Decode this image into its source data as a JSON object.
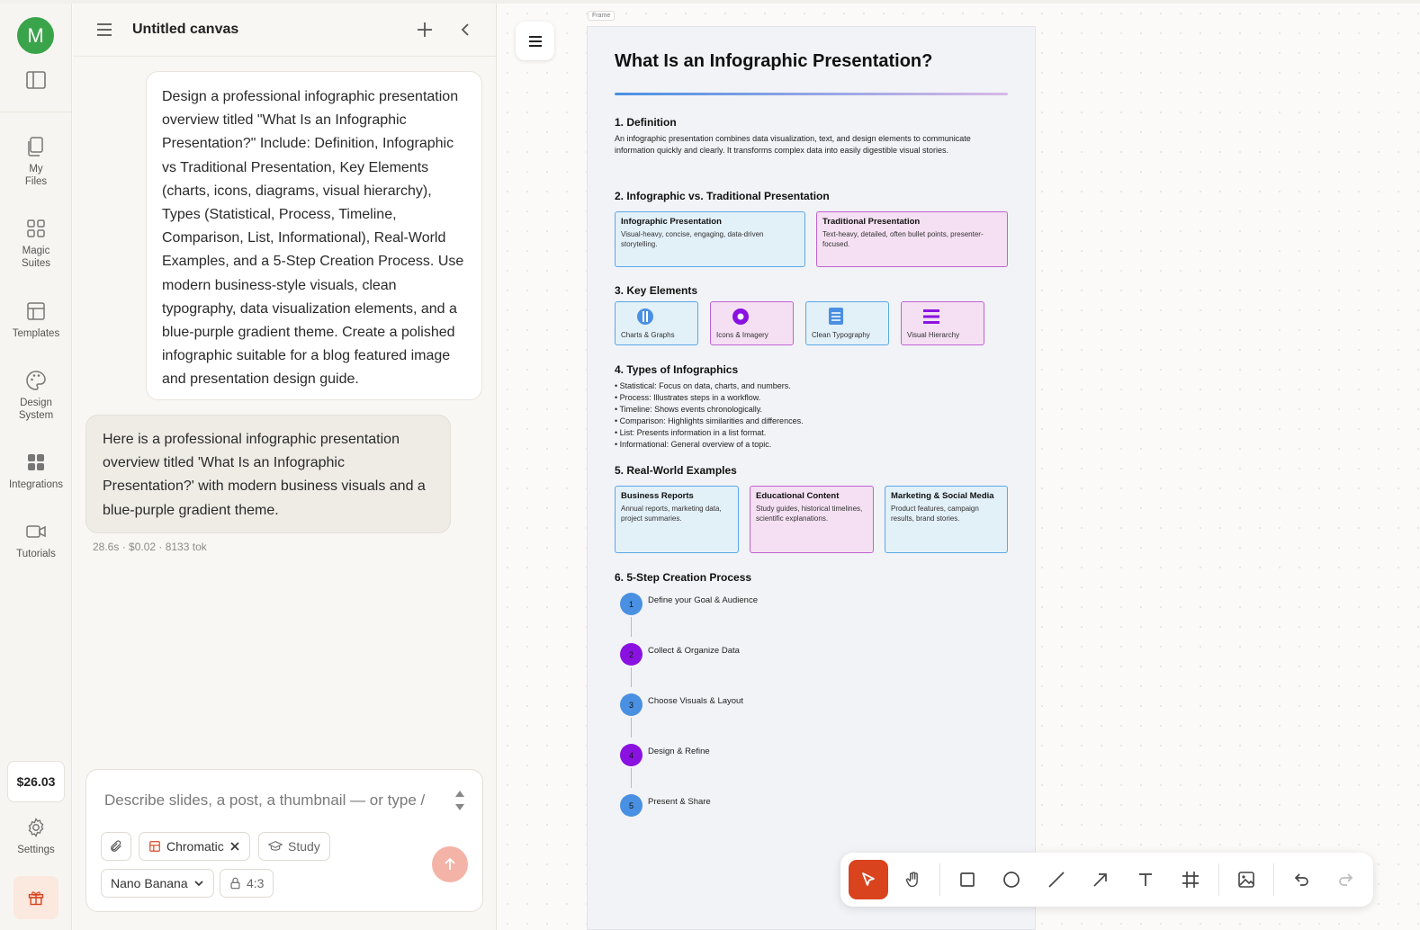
{
  "rail": {
    "avatar_initial": "M",
    "items": [
      {
        "label_line1": "My",
        "label_line2": "Files",
        "icon": "files-icon"
      },
      {
        "label_line1": "Magic",
        "label_line2": "Suites",
        "icon": "grid-icon"
      },
      {
        "label_line1": "Templates",
        "label_line2": "",
        "icon": "templates-icon"
      },
      {
        "label_line1": "Design",
        "label_line2": "System",
        "icon": "palette-icon"
      },
      {
        "label_line1": "Integrations",
        "label_line2": "",
        "icon": "integrations-icon"
      },
      {
        "label_line1": "Tutorials",
        "label_line2": "",
        "icon": "video-icon"
      }
    ],
    "balance": "$26.03",
    "settings_label": "Settings"
  },
  "chat": {
    "title": "Untitled canvas",
    "user_message": "Design a professional infographic presentation overview titled \"What Is an Infographic Presentation?\" Include: Definition, Infographic vs Traditional Presentation, Key Elements (charts, icons, diagrams, visual hierarchy), Types (Statistical, Process, Timeline, Comparison, List, Informational), Real-World Examples, and a 5-Step Creation Process. Use modern business-style visuals, clean typography, data visualization elements, and a blue-purple gradient theme. Create a polished infographic suitable for a blog featured image and presentation design guide.",
    "bot_message": "Here is a professional infographic presentation overview titled 'What Is an Infographic Presentation?' with modern business visuals and a blue-purple gradient theme.",
    "meta": "28.6s · $0.02 · 8133 tok",
    "composer": {
      "placeholder": "Describe slides, a post, a thumbnail — or type /",
      "chip_style": "Chromatic",
      "chip_mode": "Study",
      "model": "Nano Banana",
      "ratio": "4:3"
    }
  },
  "canvas": {
    "frame_label": "Frame",
    "infographic": {
      "title": "What Is an Infographic Presentation?",
      "s1_title": "1. Definition",
      "s1_body": "An infographic presentation combines data visualization, text, and design elements to communicate information quickly and clearly. It transforms complex data into easily digestible visual stories.",
      "s2_title": "2. Infographic vs. Traditional Presentation",
      "s2_left_title": "Infographic Presentation",
      "s2_left_body": "Visual-heavy, concise, engaging, data-driven storytelling.",
      "s2_right_title": "Traditional Presentation",
      "s2_right_body": "Text-heavy, detailed, often bullet points, presenter-focused.",
      "s3_title": "3. Key Elements",
      "s3_items": [
        "Charts & Graphs",
        "Icons & Imagery",
        "Clean Typography",
        "Visual Hierarchy"
      ],
      "s4_title": "4. Types of Infographics",
      "s4_items": [
        "• Statistical: Focus on data, charts, and numbers.",
        "• Process: Illustrates steps in a workflow.",
        "• Timeline: Shows events chronologically.",
        "• Comparison: Highlights similarities and differences.",
        "• List: Presents information in a list format.",
        "• Informational: General overview of a topic."
      ],
      "s5_title": "5. Real-World Examples",
      "s5_items": [
        {
          "title": "Business Reports",
          "body": "Annual reports, marketing data, project summaries."
        },
        {
          "title": "Educational Content",
          "body": "Study guides, historical timelines, scientific explanations."
        },
        {
          "title": "Marketing & Social Media",
          "body": "Product features, campaign results, brand stories."
        }
      ],
      "s6_title": "6. 5-Step Creation Process",
      "s6_steps": [
        {
          "num": "1",
          "label": "Define your Goal & Audience"
        },
        {
          "num": "2",
          "label": "Collect & Organize Data"
        },
        {
          "num": "3",
          "label": "Choose Visuals & Layout"
        },
        {
          "num": "4",
          "label": "Design & Refine"
        },
        {
          "num": "5",
          "label": "Present & Share"
        }
      ]
    }
  },
  "colors": {
    "accent": "#d9431e",
    "blue": "#4a90e2",
    "purple": "#8a12e0",
    "avatar": "#3aa44a"
  }
}
